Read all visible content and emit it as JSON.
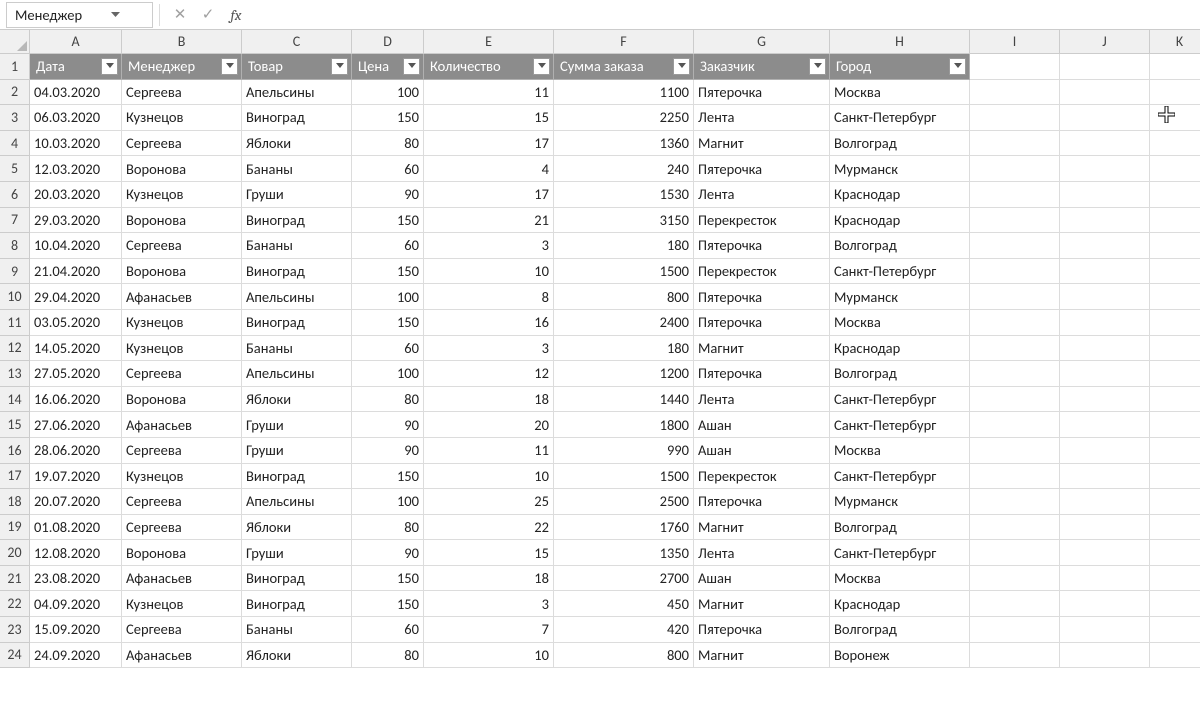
{
  "name_box": "Менеджер",
  "formula": "",
  "column_letters": [
    "A",
    "B",
    "C",
    "D",
    "E",
    "F",
    "G",
    "H",
    "I",
    "J",
    "K"
  ],
  "headers": [
    "Дата",
    "Менеджер",
    "Товар",
    "Цена",
    "Количество",
    "Сумма заказа",
    "Заказчик",
    "Город"
  ],
  "rows": [
    {
      "n": 1
    },
    {
      "n": 2,
      "A": "04.03.2020",
      "B": "Сергеева",
      "C": "Апельсины",
      "D": "100",
      "E": "11",
      "F": "1100",
      "G": "Пятерочка",
      "H": "Москва"
    },
    {
      "n": 3,
      "A": "06.03.2020",
      "B": "Кузнецов",
      "C": "Виноград",
      "D": "150",
      "E": "15",
      "F": "2250",
      "G": "Лента",
      "H": "Санкт-Петербург"
    },
    {
      "n": 4,
      "A": "10.03.2020",
      "B": "Сергеева",
      "C": "Яблоки",
      "D": "80",
      "E": "17",
      "F": "1360",
      "G": "Магнит",
      "H": "Волгоград"
    },
    {
      "n": 5,
      "A": "12.03.2020",
      "B": "Воронова",
      "C": "Бананы",
      "D": "60",
      "E": "4",
      "F": "240",
      "G": "Пятерочка",
      "H": "Мурманск"
    },
    {
      "n": 6,
      "A": "20.03.2020",
      "B": "Кузнецов",
      "C": "Груши",
      "D": "90",
      "E": "17",
      "F": "1530",
      "G": "Лента",
      "H": "Краснодар"
    },
    {
      "n": 7,
      "A": "29.03.2020",
      "B": "Воронова",
      "C": "Виноград",
      "D": "150",
      "E": "21",
      "F": "3150",
      "G": "Перекресток",
      "H": "Краснодар"
    },
    {
      "n": 8,
      "A": "10.04.2020",
      "B": "Сергеева",
      "C": "Бананы",
      "D": "60",
      "E": "3",
      "F": "180",
      "G": "Пятерочка",
      "H": "Волгоград"
    },
    {
      "n": 9,
      "A": "21.04.2020",
      "B": "Воронова",
      "C": "Виноград",
      "D": "150",
      "E": "10",
      "F": "1500",
      "G": "Перекресток",
      "H": "Санкт-Петербург"
    },
    {
      "n": 10,
      "A": "29.04.2020",
      "B": "Афанасьев",
      "C": "Апельсины",
      "D": "100",
      "E": "8",
      "F": "800",
      "G": "Пятерочка",
      "H": "Мурманск"
    },
    {
      "n": 11,
      "A": "03.05.2020",
      "B": "Кузнецов",
      "C": "Виноград",
      "D": "150",
      "E": "16",
      "F": "2400",
      "G": "Пятерочка",
      "H": "Москва"
    },
    {
      "n": 12,
      "A": "14.05.2020",
      "B": "Кузнецов",
      "C": "Бананы",
      "D": "60",
      "E": "3",
      "F": "180",
      "G": "Магнит",
      "H": "Краснодар"
    },
    {
      "n": 13,
      "A": "27.05.2020",
      "B": "Сергеева",
      "C": "Апельсины",
      "D": "100",
      "E": "12",
      "F": "1200",
      "G": "Пятерочка",
      "H": "Волгоград"
    },
    {
      "n": 14,
      "A": "16.06.2020",
      "B": "Воронова",
      "C": "Яблоки",
      "D": "80",
      "E": "18",
      "F": "1440",
      "G": "Лента",
      "H": "Санкт-Петербург"
    },
    {
      "n": 15,
      "A": "27.06.2020",
      "B": "Афанасьев",
      "C": "Груши",
      "D": "90",
      "E": "20",
      "F": "1800",
      "G": "Ашан",
      "H": "Санкт-Петербург"
    },
    {
      "n": 16,
      "A": "28.06.2020",
      "B": "Сергеева",
      "C": "Груши",
      "D": "90",
      "E": "11",
      "F": "990",
      "G": "Ашан",
      "H": "Москва"
    },
    {
      "n": 17,
      "A": "19.07.2020",
      "B": "Кузнецов",
      "C": "Виноград",
      "D": "150",
      "E": "10",
      "F": "1500",
      "G": "Перекресток",
      "H": "Санкт-Петербург"
    },
    {
      "n": 18,
      "A": "20.07.2020",
      "B": "Сергеева",
      "C": "Апельсины",
      "D": "100",
      "E": "25",
      "F": "2500",
      "G": "Пятерочка",
      "H": "Мурманск"
    },
    {
      "n": 19,
      "A": "01.08.2020",
      "B": "Сергеева",
      "C": "Яблоки",
      "D": "80",
      "E": "22",
      "F": "1760",
      "G": "Магнит",
      "H": "Волгоград"
    },
    {
      "n": 20,
      "A": "12.08.2020",
      "B": "Воронова",
      "C": "Груши",
      "D": "90",
      "E": "15",
      "F": "1350",
      "G": "Лента",
      "H": "Санкт-Петербург"
    },
    {
      "n": 21,
      "A": "23.08.2020",
      "B": "Афанасьев",
      "C": "Виноград",
      "D": "150",
      "E": "18",
      "F": "2700",
      "G": "Ашан",
      "H": "Москва"
    },
    {
      "n": 22,
      "A": "04.09.2020",
      "B": "Кузнецов",
      "C": "Виноград",
      "D": "150",
      "E": "3",
      "F": "450",
      "G": "Магнит",
      "H": "Краснодар"
    },
    {
      "n": 23,
      "A": "15.09.2020",
      "B": "Сергеева",
      "C": "Бананы",
      "D": "60",
      "E": "7",
      "F": "420",
      "G": "Пятерочка",
      "H": "Волгоград"
    },
    {
      "n": 24,
      "A": "24.09.2020",
      "B": "Афанасьев",
      "C": "Яблоки",
      "D": "80",
      "E": "10",
      "F": "800",
      "G": "Магнит",
      "H": "Воронеж"
    }
  ],
  "numeric_columns": [
    "D",
    "E",
    "F"
  ]
}
